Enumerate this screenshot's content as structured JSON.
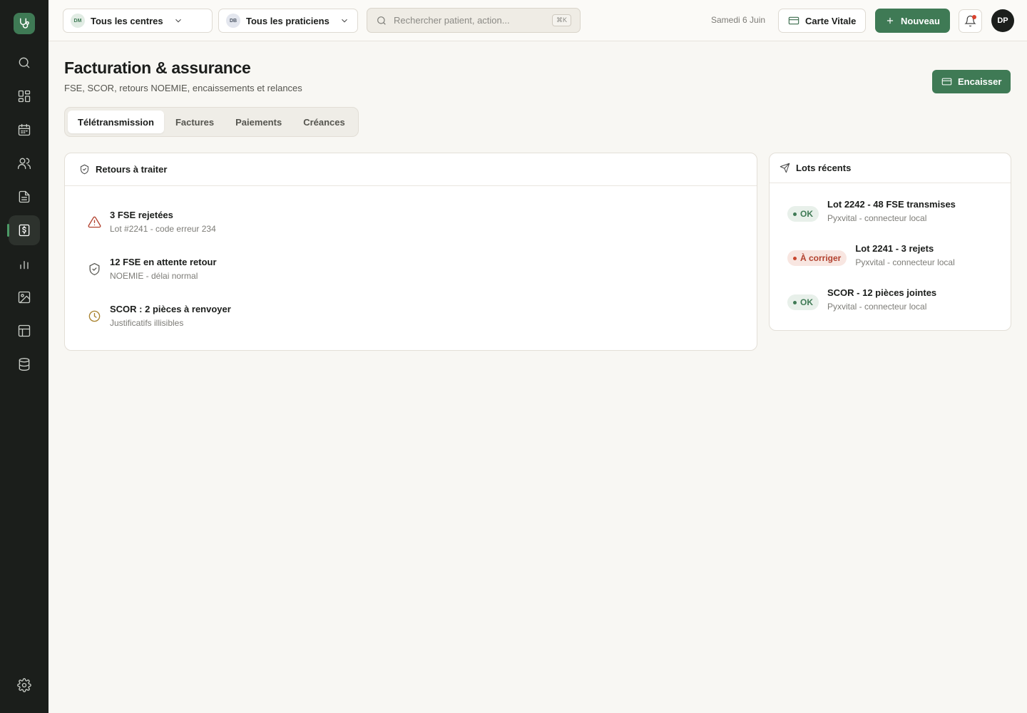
{
  "sidebar": {
    "logo_icon": "stethoscope-icon",
    "items": [
      {
        "name": "search",
        "icon": "search-icon"
      },
      {
        "name": "dashboard",
        "icon": "grid-icon"
      },
      {
        "name": "agenda",
        "icon": "calendar-icon"
      },
      {
        "name": "patients",
        "icon": "users-icon"
      },
      {
        "name": "documents",
        "icon": "file-text-icon"
      },
      {
        "name": "billing",
        "icon": "receipt-dollar-icon",
        "active": true
      },
      {
        "name": "stats",
        "icon": "bar-chart-icon"
      },
      {
        "name": "imagery",
        "icon": "image-icon"
      },
      {
        "name": "tables",
        "icon": "table-icon"
      },
      {
        "name": "database",
        "icon": "database-icon"
      }
    ],
    "settings_icon": "gear-icon"
  },
  "topbar": {
    "center_select": {
      "initials": "DM",
      "label": "Tous les centres"
    },
    "practitioner_select": {
      "initials": "DB",
      "label": "Tous les praticiens"
    },
    "search": {
      "placeholder": "Rechercher patient, action...",
      "shortcut": "⌘K"
    },
    "date": "Samedi 6 Juin",
    "carte_vitale_label": "Carte Vitale",
    "new_label": "Nouveau",
    "avatar_initials": "DP"
  },
  "page": {
    "title": "Facturation & assurance",
    "subtitle": "FSE, SCOR, retours NOEMIE, encaissements et relances",
    "encaisser_label": "Encaisser"
  },
  "tabs": [
    {
      "label": "Télétransmission",
      "active": true
    },
    {
      "label": "Factures",
      "active": false
    },
    {
      "label": "Paiements",
      "active": false
    },
    {
      "label": "Créances",
      "active": false
    }
  ],
  "returns": {
    "title": "Retours à traiter",
    "items": [
      {
        "title": "3 FSE rejetées",
        "sub": "Lot #2241 - code erreur 234",
        "icon": "warning-triangle-icon",
        "color": "#b2412e"
      },
      {
        "title": "12 FSE en attente retour",
        "sub": "NOEMIE - délai normal",
        "icon": "shield-check-icon",
        "color": "#5b5b56"
      },
      {
        "title": "SCOR : 2 pièces à renvoyer",
        "sub": "Justificatifs illisibles",
        "icon": "clock-icon",
        "color": "#a8822e"
      }
    ]
  },
  "lots": {
    "title": "Lots récents",
    "items": [
      {
        "badge": "OK",
        "status": "ok",
        "title": "Lot 2242 - 48 FSE transmises",
        "sub": "Pyxvital - connecteur local"
      },
      {
        "badge": "À corriger",
        "status": "err",
        "title": "Lot 2241 - 3 rejets",
        "sub": "Pyxvital - connecteur local"
      },
      {
        "badge": "OK",
        "status": "ok",
        "title": "SCOR - 12 pièces jointes",
        "sub": "Pyxvital - connecteur local"
      }
    ]
  },
  "colors": {
    "accent": "#3f7a55",
    "sidebar_bg": "#1b1e1b",
    "error": "#b2412e",
    "warning": "#a8822e"
  }
}
